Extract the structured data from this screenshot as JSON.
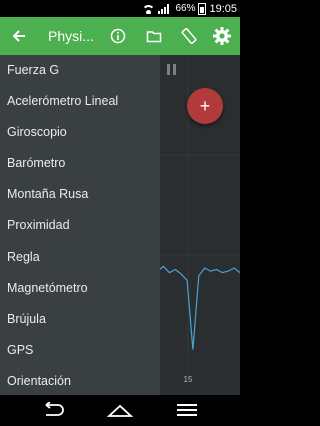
{
  "status": {
    "battery": "66%",
    "time": "19:05"
  },
  "app_bar": {
    "title": "Physi..."
  },
  "drawer": {
    "items": [
      "Fuerza G",
      "Acelerómetro Lineal",
      "Giroscopio",
      "Barómetro",
      "Montaña Rusa",
      "Proximidad",
      "Regla",
      "Magnetómetro",
      "Brújula",
      "GPS",
      "Orientación"
    ]
  },
  "chart_data": {
    "type": "line",
    "x_ticks": [
      "15"
    ],
    "series": [
      {
        "values": [
          0.62,
          0.6,
          0.63,
          0.61,
          0.64,
          0.6,
          0.62,
          0.59,
          0.55,
          0.1,
          0.58,
          0.63,
          0.61,
          0.62,
          0.6,
          0.61,
          0.63,
          0.6
        ]
      }
    ]
  },
  "colors": {
    "app_bar": "#4caf50",
    "drawer": "#3a3f41",
    "line": "#4aa3d1",
    "fab": "#b23a3a"
  }
}
